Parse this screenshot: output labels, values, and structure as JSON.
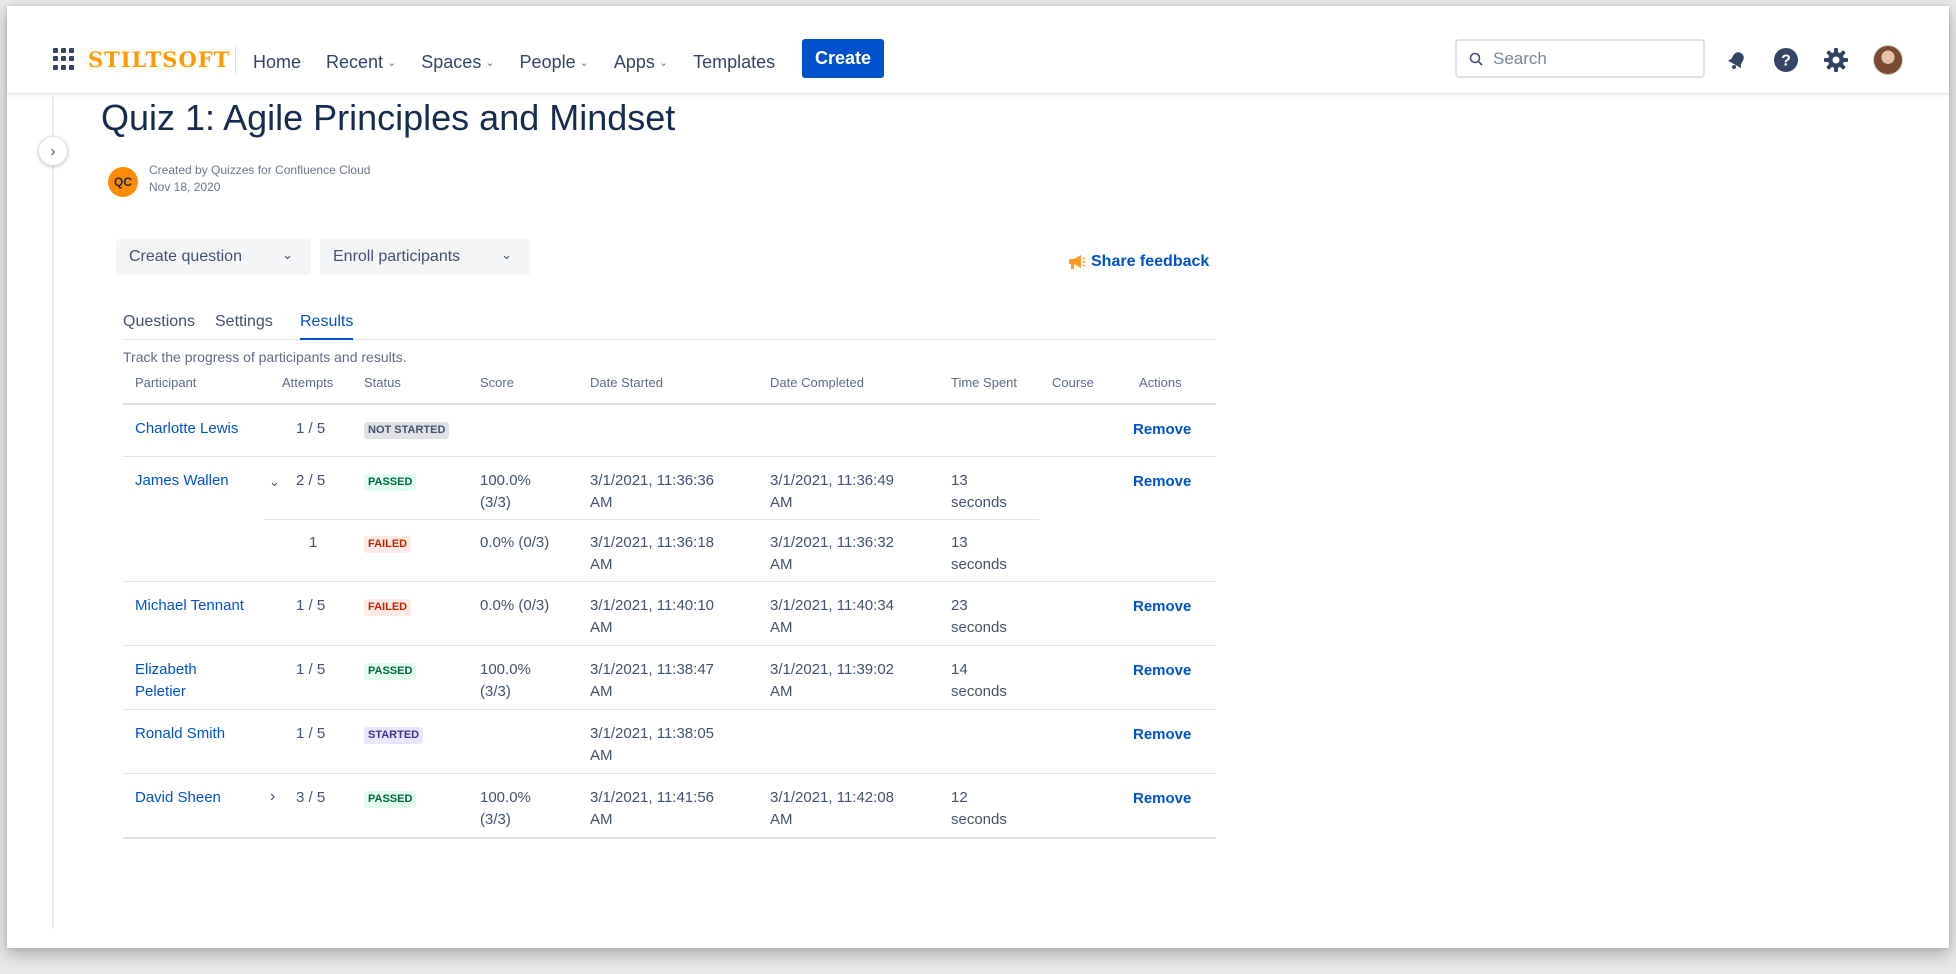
{
  "topnav": {
    "logo": "STILTSOFT",
    "links": [
      "Home",
      "Recent",
      "Spaces",
      "People",
      "Apps",
      "Templates"
    ],
    "create_label": "Create",
    "search_placeholder": "Search"
  },
  "page": {
    "title": "Quiz 1: Agile Principles and Mindset",
    "author_initials": "QC",
    "created_by": "Created by Quizzes for Confluence Cloud",
    "created_date": "Nov 18, 2020"
  },
  "toolbar": {
    "create_question": "Create question",
    "enroll_participants": "Enroll participants",
    "share_feedback": "Share feedback"
  },
  "tabs": [
    "Questions",
    "Settings",
    "Results"
  ],
  "active_tab": "Results",
  "results": {
    "intro": "Track the progress of participants and results.",
    "columns": [
      "Participant",
      "Attempts",
      "Status",
      "Score",
      "Date Started",
      "Date Completed",
      "Time Spent",
      "Course",
      "Actions"
    ],
    "action_label": "Remove",
    "rows": [
      {
        "participant": "Charlotte Lewis",
        "attempts": "1 / 5",
        "status": "NOT STARTED",
        "score": "",
        "score2": "",
        "started": "",
        "started2": "",
        "completed": "",
        "completed2": "",
        "time": "",
        "time2": "",
        "expand": ""
      },
      {
        "participant": "James Wallen",
        "attempts": "2 / 5",
        "status": "PASSED",
        "score": "100.0%",
        "score2": "(3/3)",
        "started": "3/1/2021, 11:36:36",
        "started2": "AM",
        "completed": "3/1/2021, 11:36:49",
        "completed2": "AM",
        "time": "13",
        "time2": "seconds",
        "expand": "expanded"
      },
      {
        "participant": "",
        "attempts": "1",
        "status": "FAILED",
        "score": "0.0% (0/3)",
        "score2": "",
        "started": "3/1/2021, 11:36:18",
        "started2": "AM",
        "completed": "3/1/2021, 11:36:32",
        "completed2": "AM",
        "time": "13",
        "time2": "seconds",
        "expand": ""
      },
      {
        "participant": "Michael Tennant",
        "attempts": "1 / 5",
        "status": "FAILED",
        "score": "0.0% (0/3)",
        "score2": "",
        "started": "3/1/2021, 11:40:10",
        "started2": "AM",
        "completed": "3/1/2021, 11:40:34",
        "completed2": "AM",
        "time": "23",
        "time2": "seconds",
        "expand": ""
      },
      {
        "participant": "Elizabeth",
        "participant2": "Peletier",
        "attempts": "1 / 5",
        "status": "PASSED",
        "score": "100.0%",
        "score2": "(3/3)",
        "started": "3/1/2021, 11:38:47",
        "started2": "AM",
        "completed": "3/1/2021, 11:39:02",
        "completed2": "AM",
        "time": "14",
        "time2": "seconds",
        "expand": ""
      },
      {
        "participant": "Ronald Smith",
        "attempts": "1 / 5",
        "status": "STARTED",
        "score": "",
        "score2": "",
        "started": "3/1/2021, 11:38:05",
        "started2": "AM",
        "completed": "",
        "completed2": "",
        "time": "",
        "time2": "",
        "expand": ""
      },
      {
        "participant": "David Sheen",
        "attempts": "3 / 5",
        "status": "PASSED",
        "score": "100.0%",
        "score2": "(3/3)",
        "started": "3/1/2021, 11:41:56",
        "started2": "AM",
        "completed": "3/1/2021, 11:42:08",
        "completed2": "AM",
        "time": "12",
        "time2": "seconds",
        "expand": "collapsed"
      }
    ]
  },
  "colors": {
    "brand": "#ff9a00",
    "primary": "#0052cc",
    "text": "#172b4d"
  }
}
